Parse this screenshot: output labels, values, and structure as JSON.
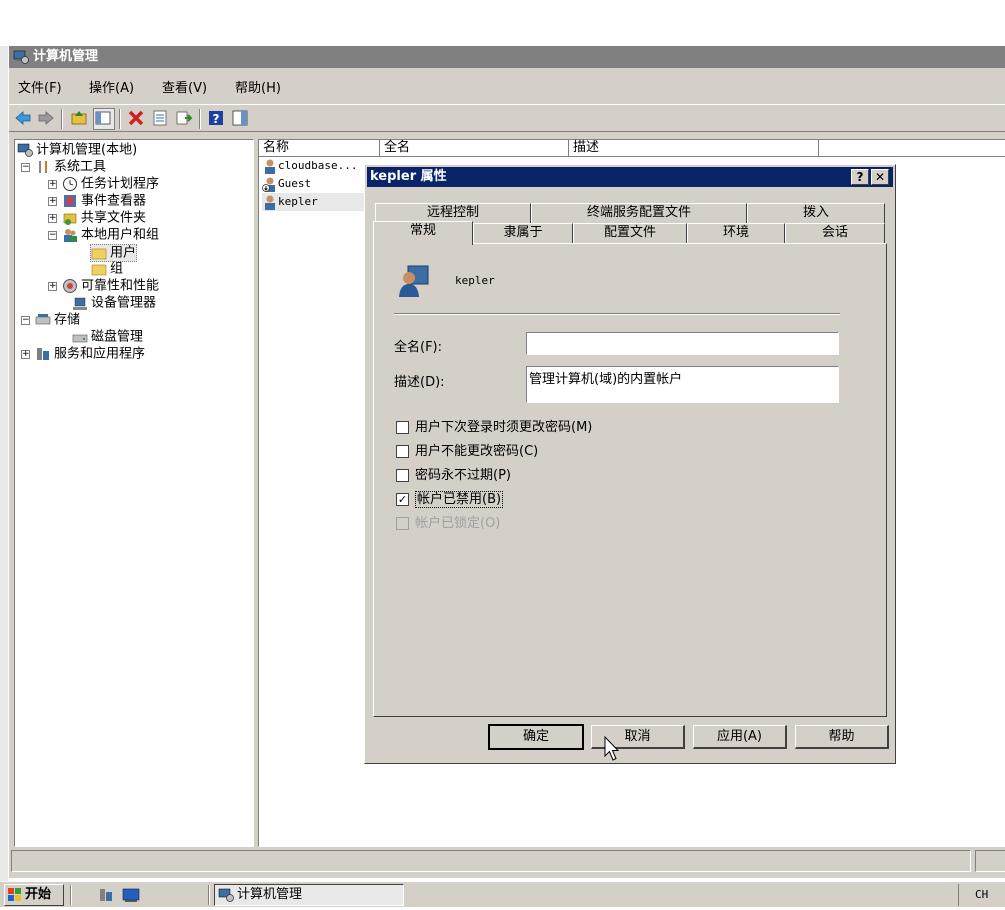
{
  "window": {
    "title": "计算机管理"
  },
  "menu": [
    "文件(F)",
    "操作(A)",
    "查看(V)",
    "帮助(H)"
  ],
  "tree": {
    "root": "计算机管理(本地)",
    "system_tools": "系统工具",
    "task_scheduler": "任务计划程序",
    "event_viewer": "事件查看器",
    "shared_folders": "共享文件夹",
    "local_users": "本地用户和组",
    "users": "用户",
    "groups": "组",
    "reliability": "可靠性和性能",
    "device_manager": "设备管理器",
    "storage": "存储",
    "disk_management": "磁盘管理",
    "services_apps": "服务和应用程序"
  },
  "list": {
    "headers": [
      "名称",
      "全名",
      "描述"
    ],
    "rows": [
      "cloudbase...",
      "Guest",
      "kepler"
    ]
  },
  "dialog": {
    "title": "kepler 属性",
    "help_btn": "?",
    "close_btn": "✕",
    "tabs_back": [
      "远程控制",
      "终端服务配置文件",
      "拨入"
    ],
    "tabs_front": [
      "常规",
      "隶属于",
      "配置文件",
      "环境",
      "会话"
    ],
    "username": "kepler",
    "fullname_label": "全名(F):",
    "fullname_value": "",
    "desc_label": "描述(D):",
    "desc_value": "管理计算机(域)的内置帐户",
    "checkboxes": [
      {
        "label": "用户下次登录时须更改密码(M)",
        "checked": false,
        "disabled": false
      },
      {
        "label": "用户不能更改密码(C)",
        "checked": false,
        "disabled": false
      },
      {
        "label": "密码永不过期(P)",
        "checked": false,
        "disabled": false
      },
      {
        "label": "帐户已禁用(B)",
        "checked": true,
        "disabled": false
      },
      {
        "label": "帐户已锁定(O)",
        "checked": false,
        "disabled": true
      }
    ],
    "buttons": [
      "确定",
      "取消",
      "应用(A)",
      "帮助"
    ]
  },
  "taskbar": {
    "start": "开始",
    "task": "计算机管理",
    "lang": "CH"
  },
  "colors": {
    "titlebar_inactive": "#808080",
    "titlebar_active": "#0a246a",
    "face": "#d4d0c8",
    "selection": "#0a246a"
  }
}
